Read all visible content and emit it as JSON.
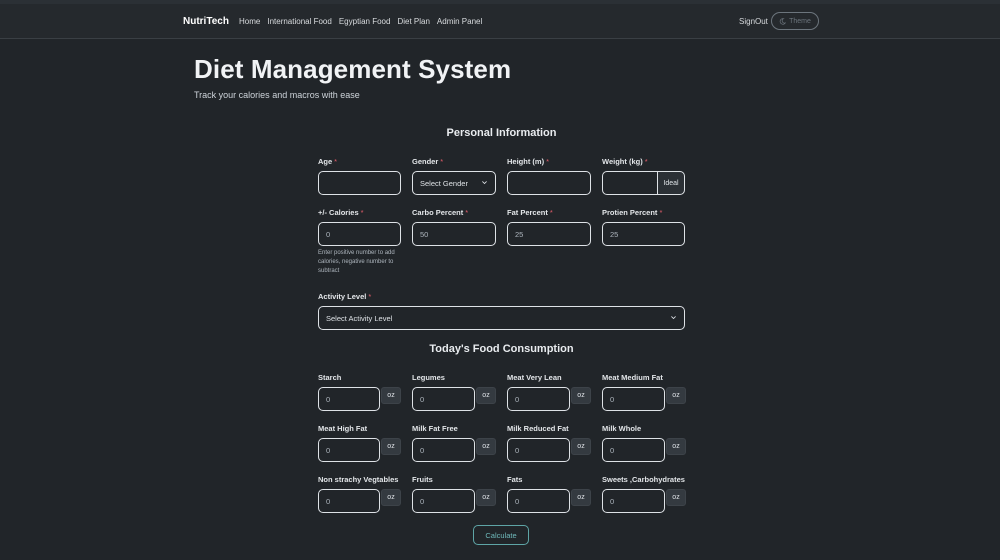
{
  "nav": {
    "brand": "NutriTech",
    "links": [
      "Home",
      "International Food",
      "Egyptian Food",
      "Diet Plan",
      "Admin Panel"
    ],
    "signout": "SignOut",
    "theme": "Theme"
  },
  "header": {
    "title": "Diet Management System",
    "subtitle": "Track your calories and macros with ease"
  },
  "personal": {
    "title": "Personal Information",
    "age": {
      "label": "Age",
      "value": ""
    },
    "gender": {
      "label": "Gender",
      "value": "Select Gender"
    },
    "height": {
      "label": "Height (m)",
      "value": ""
    },
    "weight": {
      "label": "Weight (kg)",
      "value": "",
      "addon": "Ideal"
    },
    "calories": {
      "label": "+/- Calories",
      "value": "0",
      "help": "Enter positive number to add calories, negative number to subtract"
    },
    "carbo": {
      "label": "Carbo Percent",
      "value": "50"
    },
    "fat": {
      "label": "Fat Percent",
      "value": "25"
    },
    "protein": {
      "label": "Protien Percent",
      "value": "25"
    },
    "activity": {
      "label": "Activity Level",
      "value": "Select Activity Level"
    },
    "required_mark": "*"
  },
  "food": {
    "title": "Today's Food Consumption",
    "unit": "oz",
    "items": [
      {
        "label": "Starch",
        "value": "0"
      },
      {
        "label": "Legumes",
        "value": "0"
      },
      {
        "label": "Meat Very Lean",
        "value": "0"
      },
      {
        "label": "Meat Medium Fat",
        "value": "0"
      },
      {
        "label": "Meat High Fat",
        "value": "0"
      },
      {
        "label": "Milk Fat Free",
        "value": "0"
      },
      {
        "label": "Milk Reduced Fat",
        "value": "0"
      },
      {
        "label": "Milk Whole",
        "value": "0"
      },
      {
        "label": "Non strachy Vegtables",
        "value": "0"
      },
      {
        "label": "Fruits",
        "value": "0"
      },
      {
        "label": "Fats",
        "value": "0"
      },
      {
        "label": "Sweets ,Carbohydrates",
        "value": "0"
      }
    ]
  },
  "actions": {
    "calculate": "Calculate"
  }
}
